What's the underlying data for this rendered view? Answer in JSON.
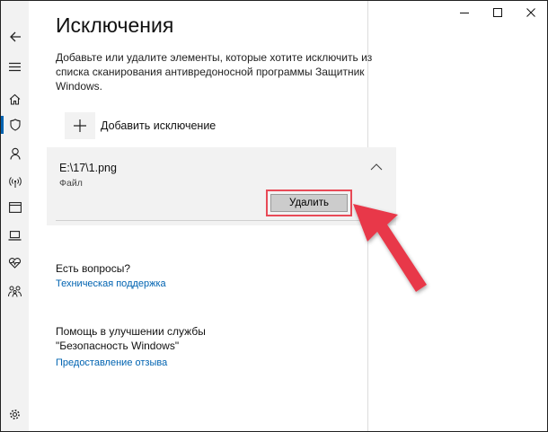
{
  "window": {
    "controls": [
      "minimize",
      "maximize",
      "close"
    ]
  },
  "sidebar": {
    "items": [
      {
        "icon": "back-arrow-icon"
      },
      {
        "icon": "hamburger-menu-icon"
      },
      {
        "icon": "home-icon"
      },
      {
        "icon": "shield-icon",
        "active": true
      },
      {
        "icon": "person-icon"
      },
      {
        "icon": "wireless-icon"
      },
      {
        "icon": "app-browser-icon"
      },
      {
        "icon": "laptop-icon"
      },
      {
        "icon": "heart-pulse-icon"
      },
      {
        "icon": "family-icon"
      },
      {
        "icon": "gear-icon"
      }
    ],
    "accent_color": "#0063b1"
  },
  "page": {
    "title": "Исключения",
    "description": "Добавьте или удалите элементы, которые хотите исключить из списка сканирования антивредоносной программы Защитник Windows."
  },
  "add_exclusion": {
    "label": "Добавить исключение"
  },
  "exclusion_item": {
    "path": "E:\\17\\1.png",
    "type": "Файл",
    "delete_label": "Удалить"
  },
  "help": {
    "heading": "Есть вопросы?",
    "link": "Техническая поддержка"
  },
  "improve": {
    "heading_line1": "Помощь в улучшении службы",
    "heading_line2": "\"Безопасность Windows\"",
    "link": "Предоставление отзыва"
  },
  "annotation": {
    "highlight_color": "#e84a57"
  }
}
